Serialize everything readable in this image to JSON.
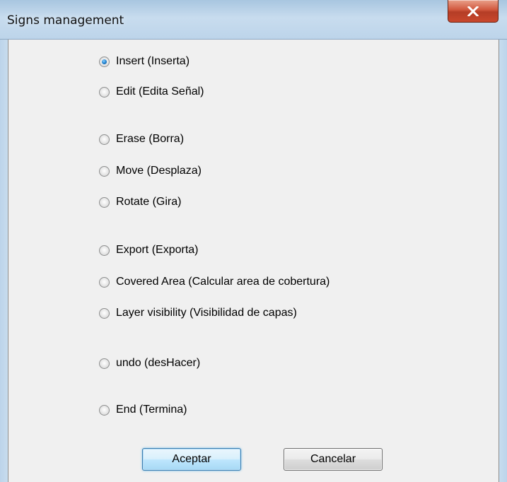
{
  "window": {
    "title": "Signs management",
    "close_label": "Close"
  },
  "options": [
    {
      "label": "Insert (Inserta)",
      "checked": true
    },
    {
      "label": "Edit (Edita Señal)",
      "checked": false
    },
    {
      "label": "Erase (Borra)",
      "checked": false
    },
    {
      "label": "Move (Desplaza)",
      "checked": false
    },
    {
      "label": "Rotate (Gira)",
      "checked": false
    },
    {
      "label": "Export (Exporta)",
      "checked": false
    },
    {
      "label": "Covered Area (Calcular area de cobertura)",
      "checked": false
    },
    {
      "label": "Layer visibility (Visibilidad de capas)",
      "checked": false
    },
    {
      "label": "undo (desHacer)",
      "checked": false
    },
    {
      "label": "End (Termina)",
      "checked": false
    }
  ],
  "buttons": {
    "accept": "Aceptar",
    "cancel": "Cancelar"
  },
  "colors": {
    "title_bar": "#bcd4ea",
    "close_button": "#c9472c",
    "radio_selected": "#2a8ad6",
    "default_button_border": "#3c7fb1"
  },
  "icons": {
    "close": "close-icon"
  }
}
